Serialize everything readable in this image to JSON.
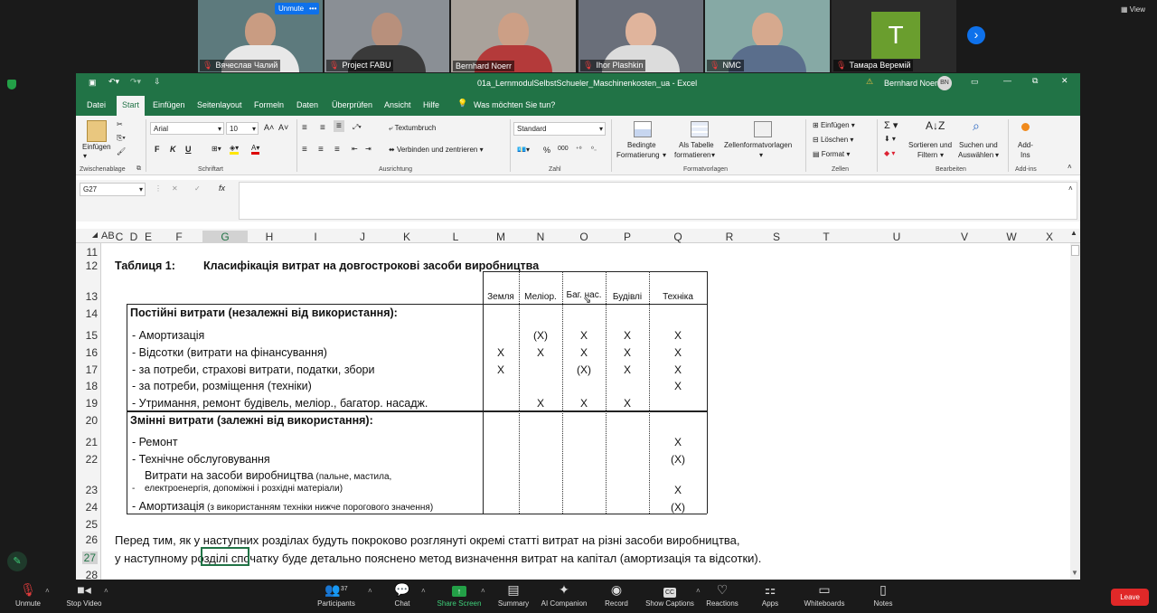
{
  "zoom": {
    "participants_top": [
      {
        "name": "Вячеслав Чалий",
        "muted": true
      },
      {
        "name": "Project FABU",
        "muted": true
      },
      {
        "name": "Bernhard Noerr",
        "muted": false
      },
      {
        "name": "Ihor Plashkin",
        "muted": true
      },
      {
        "name": "NMC",
        "muted": true
      },
      {
        "name": "Тамара Веремій",
        "muted": true
      }
    ],
    "unmute_badge": "Unmute",
    "dots_badge": "•••",
    "avatar_letter": "T",
    "view_label": "View",
    "next_icon": "›",
    "toolbar": {
      "unmute": "Unmute",
      "stop_video": "Stop Video",
      "participants": "Participants",
      "participants_count": "37",
      "chat": "Chat",
      "share_screen": "Share Screen",
      "summary": "Summary",
      "ai_companion": "AI Companion",
      "record": "Record",
      "show_captions": "Show Captions",
      "reactions": "Reactions",
      "apps": "Apps",
      "whiteboards": "Whiteboards",
      "notes": "Notes",
      "leave": "Leave"
    }
  },
  "excel": {
    "title": "01a_LernmodulSelbstSchueler_Maschinenkosten_ua  -  Excel",
    "user": "Bernhard Noerr",
    "user_initials": "BN",
    "warning_icon": "⚠",
    "tabs": [
      "Datei",
      "Start",
      "Einfügen",
      "Seitenlayout",
      "Formeln",
      "Daten",
      "Überprüfen",
      "Ansicht",
      "Hilfe"
    ],
    "active_tab": "Start",
    "tell_me": "Was möchten Sie tun?",
    "ribbon": {
      "paste": "Einfügen",
      "clipboard": "Zwischenablage",
      "font_name": "Arial",
      "font_size": "10",
      "font": "Schriftart",
      "bold": "F",
      "italic": "K",
      "underline": "U",
      "wrap": "Textumbruch",
      "merge": "Verbinden und zentrieren",
      "alignment": "Ausrichtung",
      "number_format": "Standard",
      "number": "Zahl",
      "percent": "%",
      "thousands": "000",
      "cond_format": "Bedingte",
      "cond_format2": "Formatierung",
      "as_table": "Als Tabelle",
      "as_table2": "formatieren",
      "cell_styles": "Zellenformatvorlagen",
      "styles": "Formatvorlagen",
      "insert": "Einfügen",
      "delete": "Löschen",
      "format": "Format",
      "cells": "Zellen",
      "sort": "Sortieren und",
      "sort2": "Filtern",
      "find": "Suchen und",
      "find2": "Auswählen",
      "editing": "Bearbeiten",
      "addins": "Add-",
      "addins2": "Ins",
      "addins_grp": "Add-ins"
    },
    "name_box": "G27",
    "fx": "fx",
    "columns": [
      "AB",
      "C",
      "D",
      "E",
      "F",
      "G",
      "H",
      "I",
      "J",
      "K",
      "L",
      "M",
      "N",
      "O",
      "P",
      "Q",
      "R",
      "S",
      "T",
      "U",
      "V",
      "W",
      "X"
    ],
    "rows": [
      "11",
      "12",
      "13",
      "14",
      "15",
      "16",
      "17",
      "18",
      "19",
      "20",
      "21",
      "22",
      "23",
      "24",
      "25",
      "26",
      "27",
      "28"
    ],
    "sheet": {
      "title_label": "Таблиця 1:",
      "title": "Класифікація витрат на довгострокові засоби виробництва",
      "headers": [
        "Земля",
        "Меліор.",
        "Баг. нас.",
        "Будівлі",
        "Техніка"
      ],
      "fixed_heading": "Постійні витрати  (незалежні від використання):",
      "fixed": [
        {
          "label": "-  Амортизація",
          "marks": [
            "",
            "(X)",
            "X",
            "X",
            "X"
          ]
        },
        {
          "label": "-  Відсотки (витрати на фінансування)",
          "marks": [
            "X",
            "X",
            "X",
            "X",
            "X"
          ]
        },
        {
          "label": "-  за потреби, страхові витрати, податки, збори",
          "marks": [
            "X",
            "",
            "(X)",
            "X",
            "X"
          ]
        },
        {
          "label": "-  за потреби, розміщення (техніки)",
          "marks": [
            "",
            "",
            "",
            "",
            "X"
          ]
        },
        {
          "label": "-  Утримання, ремонт будівель, меліор., багатор. насадж.",
          "marks": [
            "",
            "X",
            "X",
            "X",
            ""
          ]
        }
      ],
      "variable_heading": "Змінні витрати (залежні від використання):",
      "variable": [
        {
          "label": "-  Ремонт",
          "marks": [
            "",
            "",
            "",
            "",
            "X"
          ]
        },
        {
          "label": "-  Технічне обслуговування",
          "marks": [
            "",
            "",
            "",
            "",
            "(X)"
          ]
        }
      ],
      "row23_line1": "Витрати на засоби виробництва",
      "row23_line1_small": " (пальне, мастила,",
      "row23_line2": "електроенергія, допоміжні і розхідні матеріали)",
      "row23_dash": "-",
      "row23_mark": "X",
      "row24_label": "-  Амортизація",
      "row24_small": " (з використанням техніки нижче порогового значення)",
      "row24_mark": "(X)",
      "note1": "Перед тим, як у наступних розділах будуть покроково розглянуті окремі статті витрат на різні засоби виробництва,",
      "note2": "у наступному розділі спочатку буде детально пояснено метод визначення витрат на капітал (амортизація та відсотки)."
    }
  }
}
